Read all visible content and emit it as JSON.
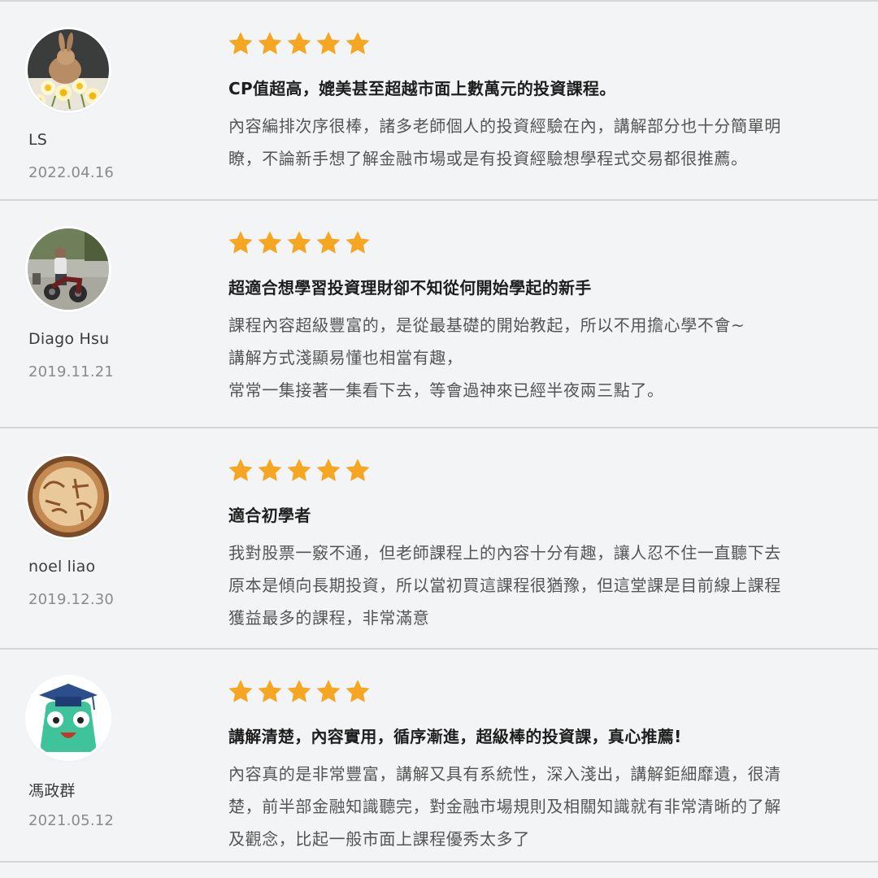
{
  "colors": {
    "star": "#f5a623",
    "background": "#f3f4f5",
    "divider": "#d6d6d6"
  },
  "reviews": [
    {
      "name": "LS",
      "date": "2022.04.16",
      "rating": 5,
      "avatar": "rabbit-with-daffodils-photo",
      "title": "CP值超高，媲美甚至超越市面上數萬元的投資課程。",
      "lines": [
        "內容編排次序很棒，諸多老師個人的投資經驗在內，講解部分也十分簡單明",
        "瞭，不論新手想了解金融市場或是有投資經驗想學程式交易都很推薦。"
      ]
    },
    {
      "name": "Diago Hsu",
      "date": "2019.11.21",
      "rating": 5,
      "avatar": "man-on-motorcycle-photo",
      "title": "超適合想學習投資理財卻不知從何開始學起的新手",
      "lines": [
        "課程內容超級豐富的，是從最基礎的開始教起，所以不用擔心學不會~",
        "講解方式淺顯易懂也相當有趣，",
        "常常一集接著一集看下去，等會過神來已經半夜兩三點了。"
      ]
    },
    {
      "name": "noel liao",
      "date": "2019.12.30",
      "rating": 5,
      "avatar": "latte-art-photo",
      "title": "適合初學者",
      "lines": [
        "我對股票一竅不通，但老師課程上的內容十分有趣，讓人忍不住一直聽下去",
        "原本是傾向長期投資，所以當初買這課程很猶豫，但這堂課是目前線上課程",
        "獲益最多的課程，非常滿意"
      ]
    },
    {
      "name": "馮政群",
      "date": "2021.05.12",
      "rating": 5,
      "avatar": "graduation-cap-character-avatar",
      "title": "講解清楚，內容實用，循序漸進，超級棒的投資課，真心推薦!",
      "lines": [
        "內容真的是非常豐富，講解又具有系統性，深入淺出，講解鉅細靡遺，很清",
        "楚，前半部金融知識聽完，對金融市場規則及相關知識就有非常清晰的了解",
        "及觀念，比起一般市面上課程優秀太多了"
      ]
    }
  ]
}
